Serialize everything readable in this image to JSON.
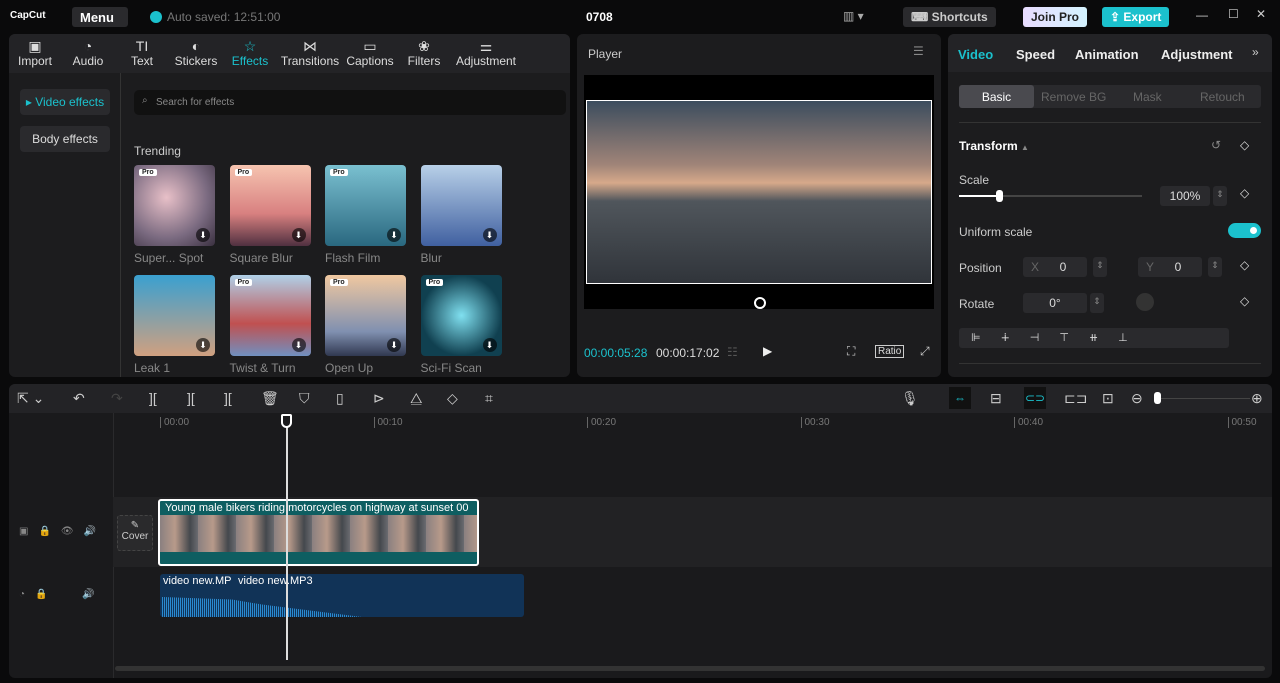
{
  "app": {
    "logo": "CapCut",
    "menu": "Menu",
    "autosave": "Auto saved: 12:51:00",
    "project": "0708",
    "shortcuts": "Shortcuts",
    "join_pro": "Join Pro",
    "export": "Export"
  },
  "toolbar": [
    {
      "label": "Import",
      "icon": "import-icon"
    },
    {
      "label": "Audio",
      "icon": "audio-icon"
    },
    {
      "label": "Text",
      "icon": "text-icon"
    },
    {
      "label": "Stickers",
      "icon": "sticker-icon"
    },
    {
      "label": "Effects",
      "icon": "effects-icon"
    },
    {
      "label": "Transitions",
      "icon": "transitions-icon"
    },
    {
      "label": "Captions",
      "icon": "captions-icon"
    },
    {
      "label": "Filters",
      "icon": "filters-icon"
    },
    {
      "label": "Adjustment",
      "icon": "adjustment-icon"
    }
  ],
  "sidebar": {
    "video_effects": "Video effects",
    "body_effects": "Body effects"
  },
  "effects": {
    "search_placeholder": "Search for effects",
    "section": "Trending",
    "items": [
      {
        "name": "Super... Spot",
        "pro": "Pro"
      },
      {
        "name": "Square Blur",
        "pro": "Pro"
      },
      {
        "name": "Flash Film",
        "pro": "Pro"
      },
      {
        "name": "Blur",
        "pro": ""
      },
      {
        "name": "Leak 1",
        "pro": ""
      },
      {
        "name": "Twist & Turn",
        "pro": "Pro"
      },
      {
        "name": "Open Up",
        "pro": "Pro"
      },
      {
        "name": "Sci-Fi Scan",
        "pro": "Pro"
      }
    ]
  },
  "player": {
    "title": "Player",
    "current": "00:00:05:28",
    "total": "00:00:17:02",
    "ratio": "Ratio"
  },
  "props": {
    "tabs": [
      "Video",
      "Speed",
      "Animation",
      "Adjustment"
    ],
    "subtabs": [
      "Basic",
      "Remove BG",
      "Mask",
      "Retouch"
    ],
    "transform": "Transform",
    "scale_label": "Scale",
    "scale": "100%",
    "scale_fraction": 0.2,
    "uniform": "Uniform scale",
    "uniform_on": true,
    "position": "Position",
    "x_label": "X",
    "x": "0",
    "y_label": "Y",
    "y": "0",
    "rotate": "Rotate",
    "rotate_val": "0°"
  },
  "timeline": {
    "ticks": [
      "00:00",
      "00:10",
      "00:20",
      "00:30",
      "00:40",
      "00:50"
    ],
    "cover": "Cover",
    "video_clip": "Young male bikers riding motorcycles on highway at sunset",
    "video_clip_time": "00",
    "audio1": "video new.MP",
    "audio2": "video new.MP3"
  },
  "colors": {
    "accent": "#1bc1cd",
    "video_track": "#0e5e61",
    "audio_track": "#113357"
  }
}
